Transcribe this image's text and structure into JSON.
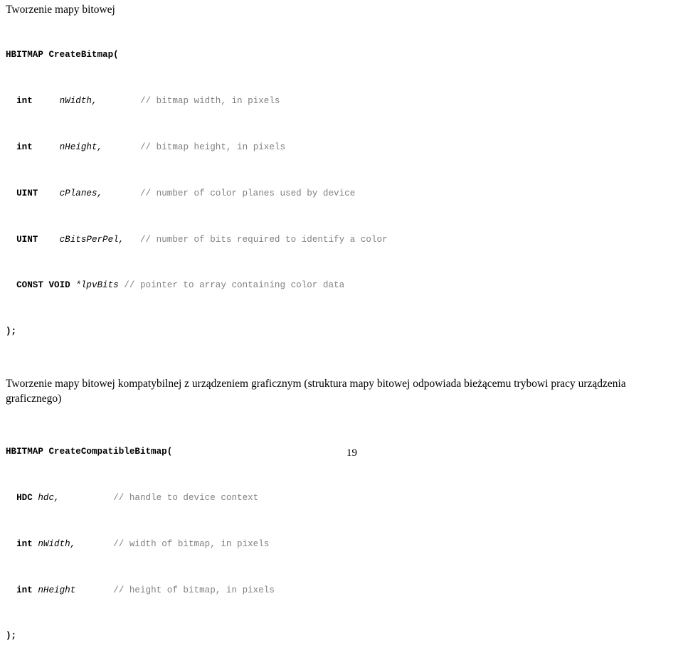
{
  "document": {
    "page_number": "19",
    "comment_color": "#808080",
    "text_color": "#000000",
    "background_color": "#ffffff"
  },
  "section1": {
    "heading": "Tworzenie mapy bitowej",
    "code": {
      "signature_return": "HBITMAP",
      "signature_name": "CreateBitmap(",
      "close": ");",
      "params": [
        {
          "type": "int",
          "type_pad": "     ",
          "name": "nWidth,",
          "name_pad": "        ",
          "comment": "// bitmap width, in pixels"
        },
        {
          "type": "int",
          "type_pad": "     ",
          "name": "nHeight,",
          "name_pad": "       ",
          "comment": "// bitmap height, in pixels"
        },
        {
          "type": "UINT",
          "type_pad": "    ",
          "name": "cPlanes,",
          "name_pad": "       ",
          "comment": "// number of color planes used by device"
        },
        {
          "type": "UINT",
          "type_pad": "    ",
          "name": "cBitsPerPel,",
          "name_pad": "   ",
          "comment": "// number of bits required to identify a color"
        },
        {
          "type": "CONST VOID",
          "type_pad": " ",
          "name": "*lpvBits",
          "name_pad": " ",
          "comment": "// pointer to array containing color data"
        }
      ]
    }
  },
  "section2": {
    "paragraph": "Tworzenie mapy bitowej kompatybilnej z urządzeniem graficznym (struktura mapy bitowej odpowiada bieżącemu trybowi pracy urządzenia graficznego)",
    "code": {
      "signature_return": "HBITMAP",
      "signature_name": "CreateCompatibleBitmap(",
      "close": ");",
      "params": [
        {
          "type": "HDC",
          "type_pad": " ",
          "name": "hdc,",
          "name_pad": "          ",
          "comment": "// handle to device context"
        },
        {
          "type": "int",
          "type_pad": " ",
          "name": "nWidth,",
          "name_pad": "       ",
          "comment": "// width of bitmap, in pixels"
        },
        {
          "type": "int",
          "type_pad": " ",
          "name": "nHeight",
          "name_pad": "       ",
          "comment": "// height of bitmap, in pixels"
        }
      ]
    }
  }
}
